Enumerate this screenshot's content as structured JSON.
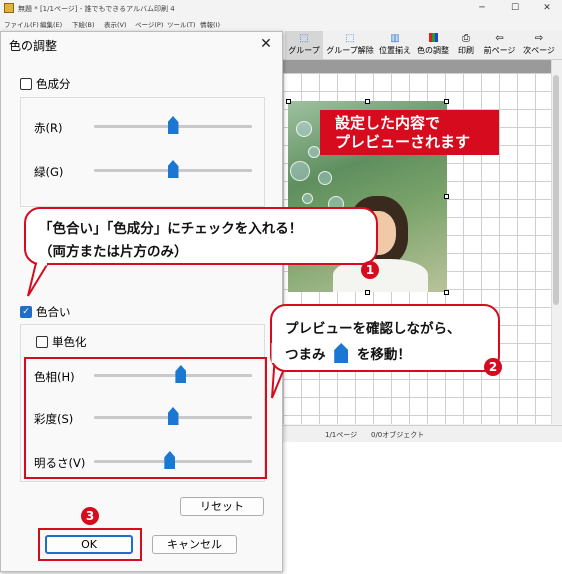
{
  "app": {
    "window_title": "無題 * [1/1ページ] - 誰でもできるアルバム印刷 4",
    "controls": {
      "minimize": "─",
      "maximize": "☐",
      "close": "✕"
    },
    "menu": [
      "ファイル(F)",
      "編集(E)",
      "下絵(B)",
      "表示(V)",
      "ページ(P)",
      "ツール(T)",
      "情報(I)"
    ],
    "toolbar": [
      {
        "label": "グループ",
        "icon": "group-icon",
        "glyph": "⬚"
      },
      {
        "label": "グループ解除",
        "icon": "ungroup-icon",
        "glyph": "⬚"
      },
      {
        "label": "位置揃え",
        "icon": "align-icon",
        "glyph": "▥"
      },
      {
        "label": "色の調整",
        "icon": "color-adjust-icon",
        "glyph": "▮"
      },
      {
        "label": "印刷",
        "icon": "printer-icon",
        "glyph": "⎙"
      },
      {
        "label": "前ページ",
        "icon": "arrow-left-icon",
        "glyph": "⇦"
      },
      {
        "label": "次ページ",
        "icon": "arrow-right-icon",
        "glyph": "⇨"
      }
    ],
    "status": {
      "page": "1/1ページ",
      "objects": "0/0オブジェクト"
    }
  },
  "dialog": {
    "title": "色の調整",
    "close": "✕",
    "color_component": {
      "checkbox_label": "色成分",
      "checked": false,
      "sliders": [
        {
          "label": "赤(R)",
          "value": 0.5
        },
        {
          "label": "緑(G)",
          "value": 0.5
        }
      ]
    },
    "hue": {
      "checkbox_label": "色合い",
      "checked": true,
      "monochrome_label": "単色化",
      "monochrome_checked": false,
      "sliders": [
        {
          "label": "色相(H)",
          "value": 0.55
        },
        {
          "label": "彩度(S)",
          "value": 0.5
        },
        {
          "label": "明るさ(V)",
          "value": 0.48
        }
      ]
    },
    "reset_label": "リセット",
    "ok_label": "OK",
    "cancel_label": "キャンセル"
  },
  "annotations": {
    "banner_line1": "設定した内容で",
    "banner_line2": "プレビューされます",
    "callout1_line1": "「色合い」「色成分」にチェックを入れる！",
    "callout1_line2": "（両方または片方のみ）",
    "callout2_line1": "プレビューを確認しながら、",
    "callout2_pre": "つまみ",
    "callout2_post": "を移動！",
    "step1": "1",
    "step2": "2",
    "step3": "3",
    "accent_red": "#d60b1e",
    "thumb_blue": "#1a77d2"
  }
}
